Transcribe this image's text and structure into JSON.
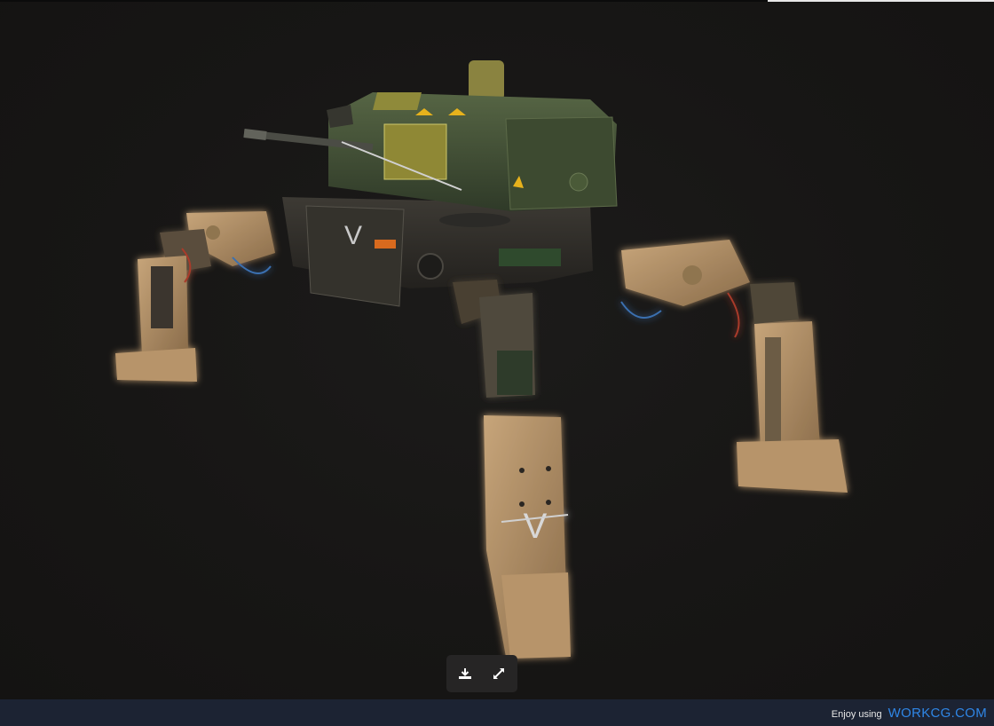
{
  "viewer": {
    "toolbar": {
      "download_icon": "download-icon",
      "fullscreen_icon": "expand-icon"
    },
    "model": {
      "turret_emblem": "V",
      "leg_emblem": "V"
    }
  },
  "footer": {
    "prefix": "Enjoy using",
    "brand": "WORKCG.COM",
    "brand_color": "#2f86e6",
    "background": "#1c2333"
  }
}
